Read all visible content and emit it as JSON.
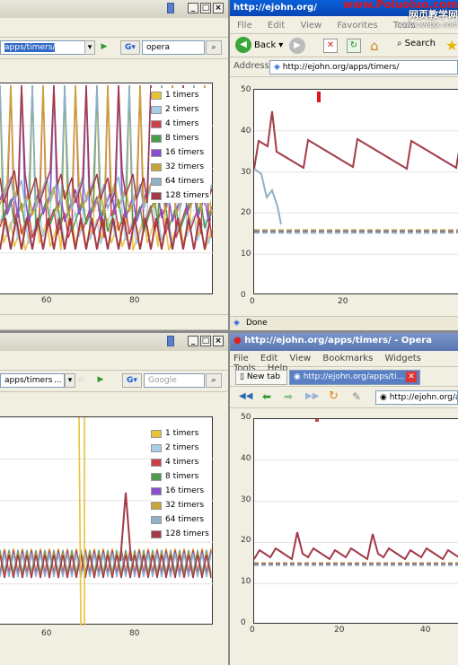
{
  "top_left": {
    "url_value": "apps/timers/",
    "search_engine_icon": "google-icon",
    "search_value": "opera",
    "legend": [
      {
        "label": "1 timers",
        "color": "#e8c33a"
      },
      {
        "label": "2 timers",
        "color": "#a9cde6"
      },
      {
        "label": "4 timers",
        "color": "#c9424a"
      },
      {
        "label": "8 timers",
        "color": "#4e9a4e"
      },
      {
        "label": "16 timers",
        "color": "#8a4fd1"
      },
      {
        "label": "32 timers",
        "color": "#c9a43a"
      },
      {
        "label": "64 timers",
        "color": "#8fb0c6"
      },
      {
        "label": "128 timers",
        "color": "#a43a48"
      }
    ],
    "x_ticks": [
      "60",
      "80"
    ]
  },
  "top_right": {
    "title": "http://ejohn.org/",
    "menu": [
      "File",
      "Edit",
      "View",
      "Favorites",
      "Tools"
    ],
    "back_label": "Back",
    "search_label": "Search",
    "address_label": "Address",
    "address_value": "http://ejohn.org/apps/timers/",
    "y_ticks": [
      "50",
      "40",
      "30",
      "20",
      "10",
      "0"
    ],
    "x_ticks": [
      "0",
      "20"
    ],
    "status_text": "Done"
  },
  "bottom_left": {
    "url_value": "apps/timers/",
    "url_suffix": "...",
    "search_placeholder": "Google",
    "legend": [
      {
        "label": "1 timers",
        "color": "#e8c33a"
      },
      {
        "label": "2 timers",
        "color": "#a9cde6"
      },
      {
        "label": "4 timers",
        "color": "#c9424a"
      },
      {
        "label": "8 timers",
        "color": "#4e9a4e"
      },
      {
        "label": "16 timers",
        "color": "#8a4fd1"
      },
      {
        "label": "32 timers",
        "color": "#c9a43a"
      },
      {
        "label": "64 timers",
        "color": "#8fb0c6"
      },
      {
        "label": "128 timers",
        "color": "#a43a48"
      }
    ],
    "x_ticks": [
      "60",
      "80"
    ]
  },
  "bottom_right": {
    "title": "http://ejohn.org/apps/timers/ - Opera",
    "menu": [
      "File",
      "Edit",
      "View",
      "Bookmarks",
      "Widgets",
      "Tools",
      "Help"
    ],
    "tab_new": "New tab",
    "tab_active": "http://ejohn.org/apps/ti...",
    "address_value": "http://ejohn.org/a",
    "y_ticks": [
      "50",
      "40",
      "30",
      "20",
      "10",
      "0"
    ],
    "x_ticks": [
      "0",
      "20",
      "40"
    ]
  },
  "watermark": {
    "line1": "www.Poluoluo.com",
    "line2": "网页教学网",
    "line3": "www.webjx.com"
  },
  "colors": {
    "xp_blue": "#0a5fd8",
    "opera_title": "#5a77b2"
  }
}
